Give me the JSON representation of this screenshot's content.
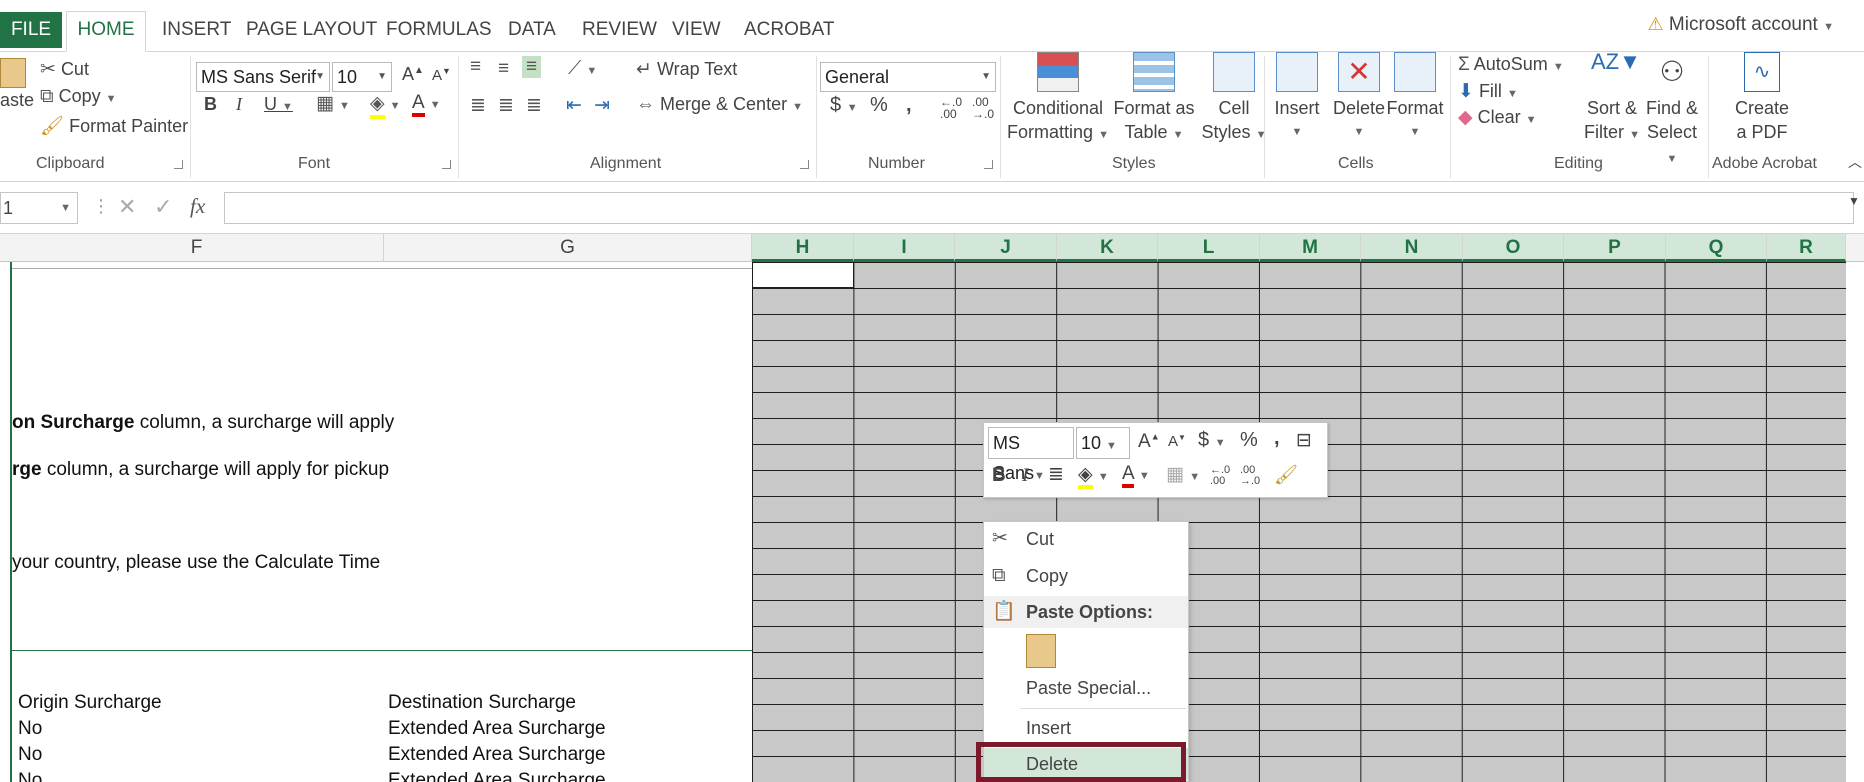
{
  "tabs": {
    "file": "FILE",
    "home": "HOME",
    "insert": "INSERT",
    "page_layout": "PAGE LAYOUT",
    "formulas": "FORMULAS",
    "data": "DATA",
    "review": "REVIEW",
    "view": "VIEW",
    "acrobat": "ACROBAT"
  },
  "account": "Microsoft account",
  "clipboard": {
    "paste": "aste",
    "cut": "Cut",
    "copy": "Copy",
    "format_painter": "Format Painter",
    "label": "Clipboard"
  },
  "font": {
    "name": "MS Sans Serif",
    "size": "10",
    "label": "Font",
    "highlight_color": "#ffff00",
    "font_color": "#e00000"
  },
  "alignment": {
    "wrap_text": "Wrap Text",
    "merge_center": "Merge & Center",
    "label": "Alignment"
  },
  "number": {
    "format": "General",
    "label": "Number"
  },
  "styles": {
    "conditional_1": "Conditional",
    "conditional_2": "Formatting",
    "format_table_1": "Format as",
    "format_table_2": "Table",
    "cell_styles_1": "Cell",
    "cell_styles_2": "Styles",
    "label": "Styles"
  },
  "cells": {
    "insert": "Insert",
    "delete": "Delete",
    "format": "Format",
    "label": "Cells"
  },
  "editing": {
    "autosum": "AutoSum",
    "fill": "Fill",
    "clear": "Clear",
    "sort_1": "Sort &",
    "sort_2": "Filter",
    "find_1": "Find &",
    "find_2": "Select",
    "label": "Editing"
  },
  "acrobat_group": {
    "create_1": "Create",
    "create_2": "a PDF",
    "label": "Adobe Acrobat"
  },
  "formula_bar": {
    "namebox": "1",
    "fx": "fx",
    "value": ""
  },
  "columns": [
    "F",
    "G",
    "H",
    "I",
    "J",
    "K",
    "L",
    "M",
    "N",
    "O",
    "P",
    "Q",
    "R"
  ],
  "sheet": {
    "line1_bold": "on Surcharge",
    "line1_rest": " column, a surcharge will apply",
    "line2_bold": "rge",
    "line2_rest": " column, a surcharge will apply for pickup",
    "line3": "your country, please use the Calculate Time",
    "hdr_origin": "Origin Surcharge",
    "hdr_destination": "Destination Surcharge",
    "rows": [
      {
        "origin": "No",
        "destination": "Extended Area Surcharge"
      },
      {
        "origin": "No",
        "destination": "Extended Area Surcharge"
      },
      {
        "origin": "No",
        "destination": "Extended Area Surcharge"
      }
    ]
  },
  "mini_toolbar": {
    "font": "MS Sans",
    "size": "10"
  },
  "context_menu": {
    "cut": "Cut",
    "copy": "Copy",
    "paste_options": "Paste Options:",
    "paste_special": "Paste Special...",
    "insert": "Insert",
    "delete": "Delete"
  },
  "colors": {
    "excel_green": "#217346",
    "selected_header_bg": "#d2e7d8",
    "highlight_border": "#7b1a2a",
    "grey_range": "#c8c8c8"
  }
}
